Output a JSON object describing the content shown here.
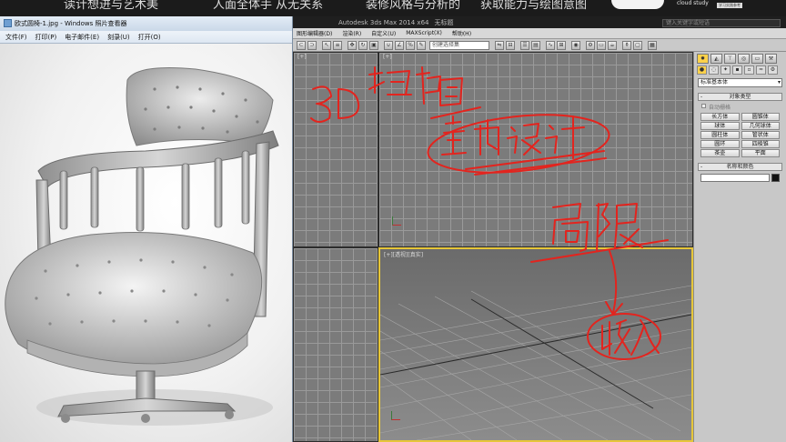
{
  "banner": {
    "segments": [
      "读计想进与艺术美",
      "人面全体手 从无关系",
      "装修风格与分析的",
      "获取能力与绘图意图"
    ],
    "brand": "cloud study",
    "brand_sub": "学习实践参考"
  },
  "photo_viewer": {
    "title": "欧式圆椅-1.jpg - Windows 照片查看器",
    "menu": [
      "文件(F)",
      "打印(P)",
      "电子邮件(E)",
      "刻录(U)",
      "打开(O)"
    ],
    "image_subject": "leather tufted swivel chair render"
  },
  "max": {
    "title": "Autodesk 3ds Max 2014 x64",
    "file": "无标题",
    "search_placeholder": "键入关键字或短语",
    "menu": [
      "图形编辑器(D)",
      "渲染(R)",
      "自定义(U)",
      "MAXScript(X)",
      "帮助(H)"
    ],
    "selection_set": "创建选择集",
    "viewports": [
      {
        "id": "top",
        "label": "[+]"
      },
      {
        "id": "front",
        "label": "[+]"
      },
      {
        "id": "left",
        "label": ""
      },
      {
        "id": "persp",
        "label": "[+][透视][真实]"
      }
    ],
    "command_panel": {
      "tabs": [
        "create",
        "modify",
        "hierarchy",
        "motion",
        "display",
        "utilities"
      ],
      "category_dropdown": "标准基本体",
      "object_type_header": "对象类型",
      "autogrid_label": "自动栅格",
      "objects": [
        "长方体",
        "圆锥体",
        "球体",
        "几何球体",
        "圆柱体",
        "管状体",
        "圆环",
        "四棱锥",
        "茶壶",
        "平面"
      ],
      "name_color_header": "名称和颜色",
      "color_swatch": "#111111"
    }
  },
  "annotations": {
    "ink_color": "#e3241e",
    "texts": [
      "3D扫描图",
      "室内设计",
      "局限",
      "收入"
    ]
  }
}
